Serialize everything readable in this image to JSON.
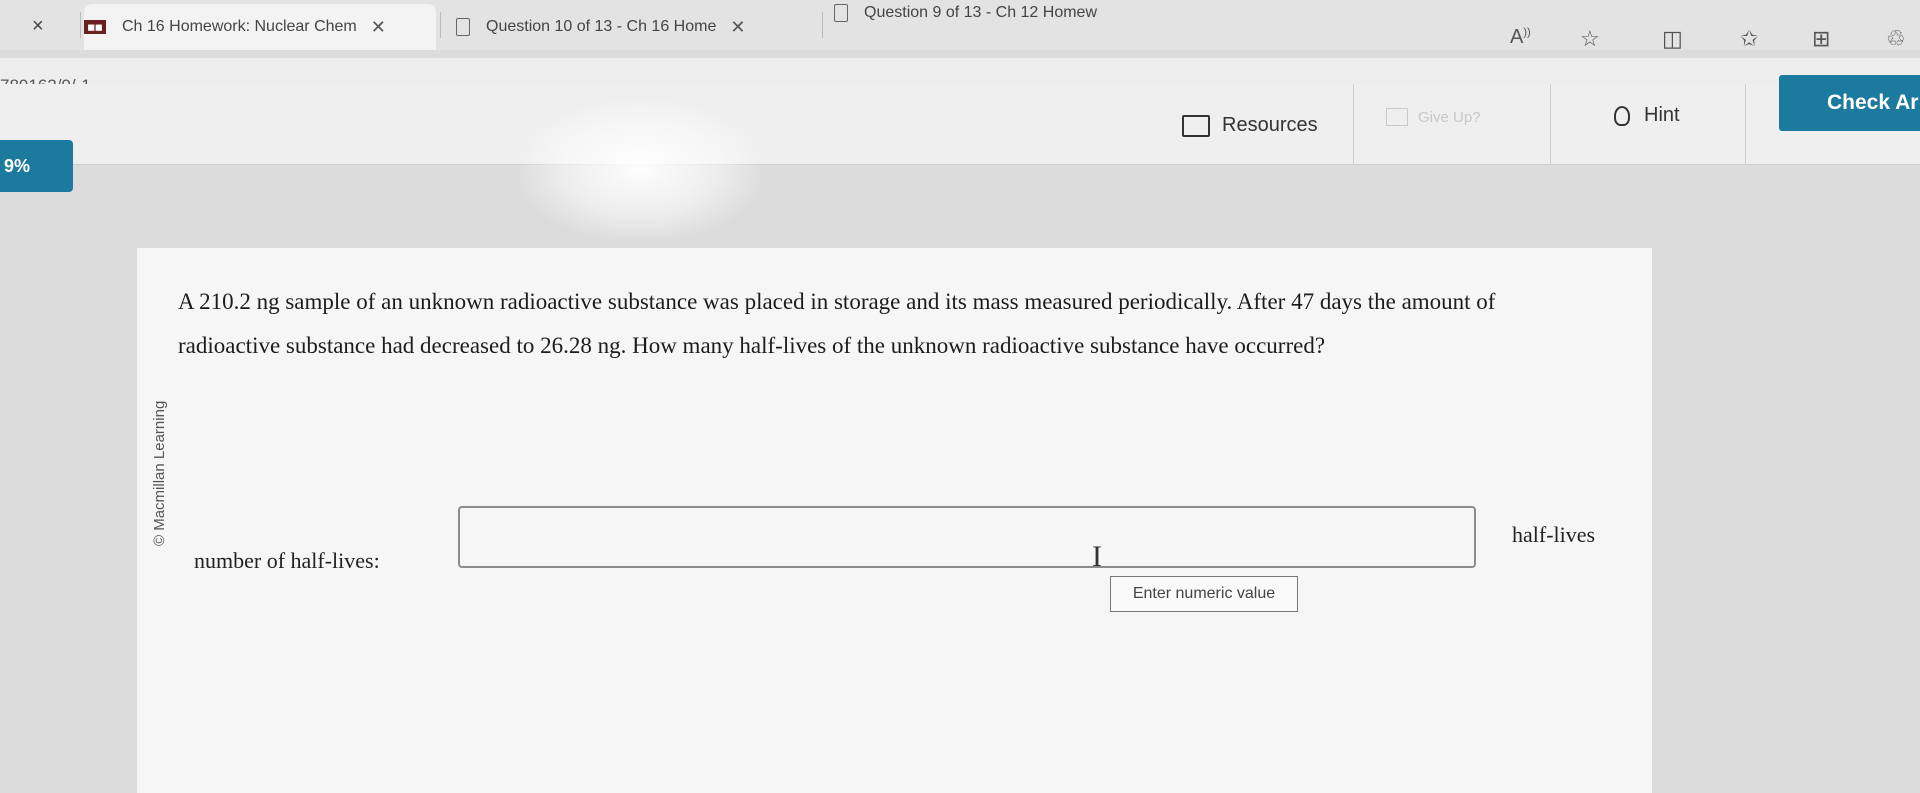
{
  "browser": {
    "tabs": [
      {
        "title": "Ch 16 Homework: Nuclear Chem",
        "favicon": "saplinglearning-icon"
      },
      {
        "title": "Question 10 of 13 - Ch 16 Home",
        "favicon": "page-icon"
      },
      {
        "title": "Question 9 of 13 - Ch 12 Homew",
        "favicon": "page-icon"
      }
    ],
    "toolbar_icons": [
      "read-aloud-icon",
      "favorite-star-icon",
      "split-screen-icon",
      "favorites-list-icon",
      "collections-icon",
      "extensions-icon"
    ]
  },
  "url": {
    "path": "789162/9/-1"
  },
  "app_toolbar": {
    "resources_label": "Resources",
    "give_up_label": "Give Up?",
    "hint_label": "Hint",
    "check_answer_label": "Check Ar"
  },
  "progress": {
    "label": "9%"
  },
  "question": {
    "publisher": "© Macmillan Learning",
    "text": "A 210.2 ng sample of an unknown radioactive substance was placed in storage and its mass measured periodically. After 47 days the amount of radioactive substance had decreased to 26.28 ng. How many half-lives of the unknown radioactive substance have occurred?",
    "answer_label": "number of half-lives:",
    "answer_value": "",
    "unit": "half-lives",
    "tooltip": "Enter numeric value"
  }
}
